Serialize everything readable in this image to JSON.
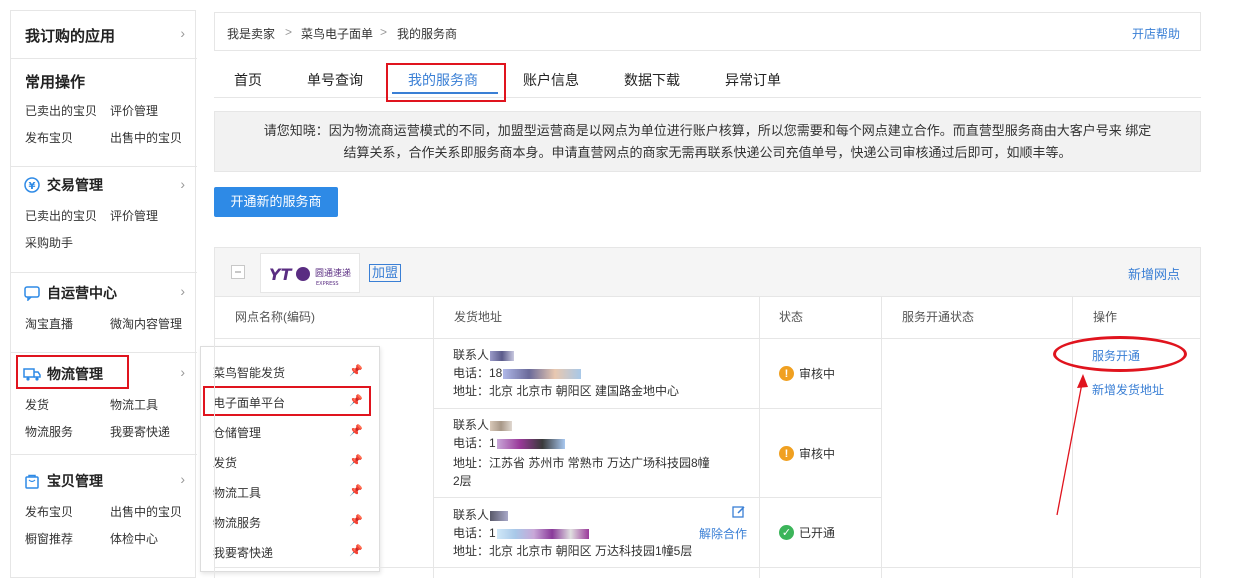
{
  "sidebar": {
    "purchased_apps": "我订购的应用",
    "common_ops": {
      "title": "常用操作",
      "links": [
        "已卖出的宝贝",
        "评价管理",
        "发布宝贝",
        "出售中的宝贝"
      ]
    },
    "trade": {
      "title": "交易管理",
      "links": [
        "已卖出的宝贝",
        "评价管理",
        "采购助手"
      ]
    },
    "self_op": {
      "title": "自运营中心",
      "links": [
        "淘宝直播",
        "微淘内容管理"
      ]
    },
    "logistics": {
      "title": "物流管理",
      "links": [
        "发货",
        "物流工具",
        "物流服务",
        "我要寄快递"
      ]
    },
    "goods": {
      "title": "宝贝管理",
      "links": [
        "发布宝贝",
        "出售中的宝贝",
        "橱窗推荐",
        "体检中心"
      ]
    },
    "chevron": "›"
  },
  "flyout": {
    "items": [
      "菜鸟智能发货",
      "电子面单平台",
      "仓储管理",
      "发货",
      "物流工具",
      "物流服务",
      "我要寄快递"
    ]
  },
  "breadcrumb": {
    "items": [
      "我是卖家",
      "菜鸟电子面单",
      "我的服务商"
    ],
    "sep": ">",
    "help": "开店帮助"
  },
  "tabs": [
    "首页",
    "单号查询",
    "我的服务商",
    "账户信息",
    "数据下载",
    "异常订单"
  ],
  "notice": {
    "line1": "请您知晓：因为物流商运营模式的不同，加盟型运营商是以网点为单位进行账户核算，所以您需要和每个网点建立合作。而直营型服务商由大客户号来 绑定",
    "line2": "结算关系，合作关系即服务商本身。申请直营网点的商家无需再联系快递公司充值单号，快递公司审核通过后即可，如顺丰等。"
  },
  "open_button": "开通新的服务商",
  "provider": {
    "logo_text": "圆通速递",
    "logo_sub": "EXPRESS",
    "logo_mark": "YT",
    "type_tag": "加盟",
    "new_point": "新增网点"
  },
  "table": {
    "headers": [
      "网点名称(编码)",
      "发货地址",
      "状态",
      "服务开通状态",
      "操作"
    ],
    "rows": [
      {
        "contact": "联系人",
        "phone": "电话：18",
        "address": "地址：北京 北京市 朝阳区 建国路金地中心",
        "address2": "",
        "status": "审核中",
        "status_kind": "pending"
      },
      {
        "contact": "联系人",
        "phone": "电话：1",
        "address": "地址：江苏省 苏州市 常熟市 万达广场科技园8幢",
        "address2": "2层",
        "status": "审核中",
        "status_kind": "pending"
      },
      {
        "contact": "联系人",
        "phone": "电话：1",
        "address": "地址：北京 北京市 朝阳区 万达科技园1幢5层",
        "address2": "",
        "status": "已开通",
        "status_kind": "ok",
        "cancel": "解除合作"
      }
    ],
    "actions": {
      "open_service": "服务开通",
      "add_address": "新增发货地址"
    }
  },
  "colors": {
    "accent": "#3a7fd5",
    "button": "#2e8ae6",
    "warning": "#f0a020",
    "success": "#3cb55a",
    "annotation": "#e0141e"
  }
}
